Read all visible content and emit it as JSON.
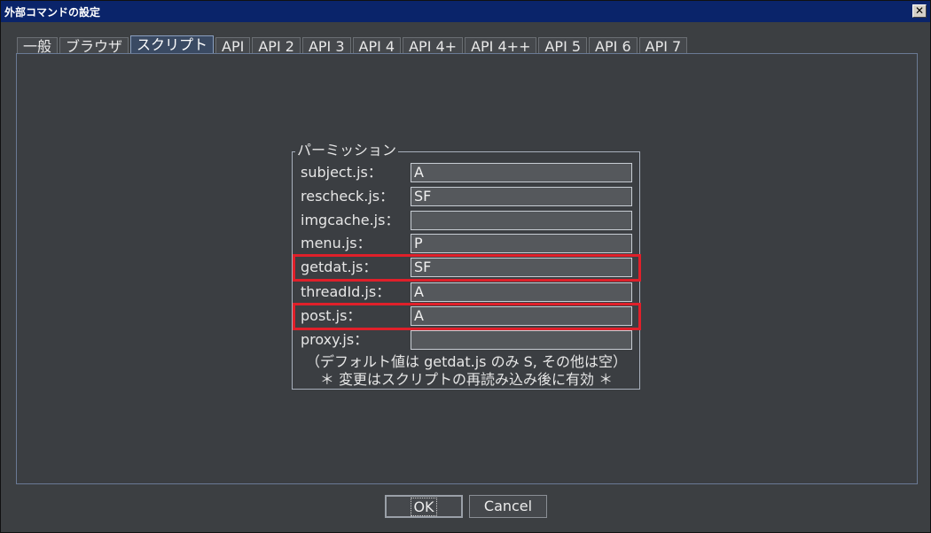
{
  "window": {
    "title": "外部コマンドの設定",
    "close_label": "✕"
  },
  "tabs": [
    {
      "label": "一般"
    },
    {
      "label": "ブラウザ"
    },
    {
      "label": "スクリプト",
      "active": true
    },
    {
      "label": "API"
    },
    {
      "label": "API 2"
    },
    {
      "label": "API 3"
    },
    {
      "label": "API 4"
    },
    {
      "label": "API 4+"
    },
    {
      "label": "API 4++"
    },
    {
      "label": "API 5"
    },
    {
      "label": "API 6"
    },
    {
      "label": "API 7"
    }
  ],
  "permissions": {
    "legend": "パーミッション",
    "rows": [
      {
        "label": "subject.js：",
        "value": "A"
      },
      {
        "label": "rescheck.js：",
        "value": "SF"
      },
      {
        "label": "imgcache.js：",
        "value": ""
      },
      {
        "label": "menu.js：",
        "value": "P"
      },
      {
        "label": "getdat.js：",
        "value": "SF"
      },
      {
        "label": "threadId.js：",
        "value": "A"
      },
      {
        "label": "post.js：",
        "value": "A"
      },
      {
        "label": "proxy.js：",
        "value": ""
      }
    ],
    "note_default": "（デフォルト値は getdat.js のみ S, その他は空）",
    "note_reload": "＊ 変更はスクリプトの再読み込み後に有効 ＊"
  },
  "buttons": {
    "ok": "OK",
    "cancel": "Cancel"
  },
  "colors": {
    "highlight": "#e0202a",
    "titlebar": "#0a246a"
  }
}
